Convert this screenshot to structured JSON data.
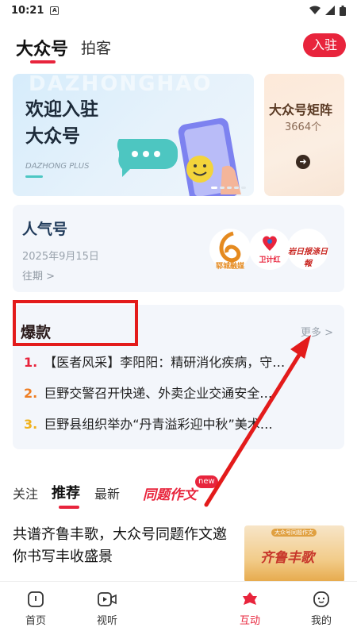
{
  "status": {
    "time": "10:21",
    "sim": "A"
  },
  "header": {
    "tab_main": "大众号",
    "tab_second": "拍客",
    "join_label": "入驻"
  },
  "banner": {
    "watermark": "DAZHONGHAO",
    "title_line1": "欢迎入驻",
    "title_line2": "大众号",
    "subtitle": "DAZHONG PLUS"
  },
  "side_card": {
    "title": "大众号矩阵",
    "count": "3664个"
  },
  "popular": {
    "title": "人气号",
    "date": "2025年9月15日",
    "past": "往期 >",
    "logos": [
      "郓城融媒",
      "卫计红",
      "岩日报涤日報"
    ]
  },
  "hot": {
    "title": "爆款",
    "more": "更多 >",
    "items": [
      {
        "num": "1.",
        "text": "【医者风采】李阳阳：精研消化疾病，守…",
        "color": "#e8243c"
      },
      {
        "num": "2.",
        "text": "巨野交警召开快递、外卖企业交通安全…",
        "color": "#ef7d22"
      },
      {
        "num": "3.",
        "text": "巨野县组织举办“丹青溢彩迎中秋”美术…",
        "color": "#f0b21e"
      }
    ]
  },
  "feed_tabs": {
    "follow": "关注",
    "recommend": "推荐",
    "latest": "最新",
    "promo": "同题作文",
    "promo_badge": "new"
  },
  "article": {
    "title": "共谱齐鲁丰歌，大众号同题作文邀你书写丰收盛景",
    "image_caption": "齐鲁丰歌",
    "image_tag": "大众号同题作文"
  },
  "bottom_nav": {
    "home": "首页",
    "video": "视听",
    "interact": "互动",
    "mine": "我的"
  },
  "colors": {
    "accent": "#e8243c",
    "annotation": "#e31b1b"
  }
}
